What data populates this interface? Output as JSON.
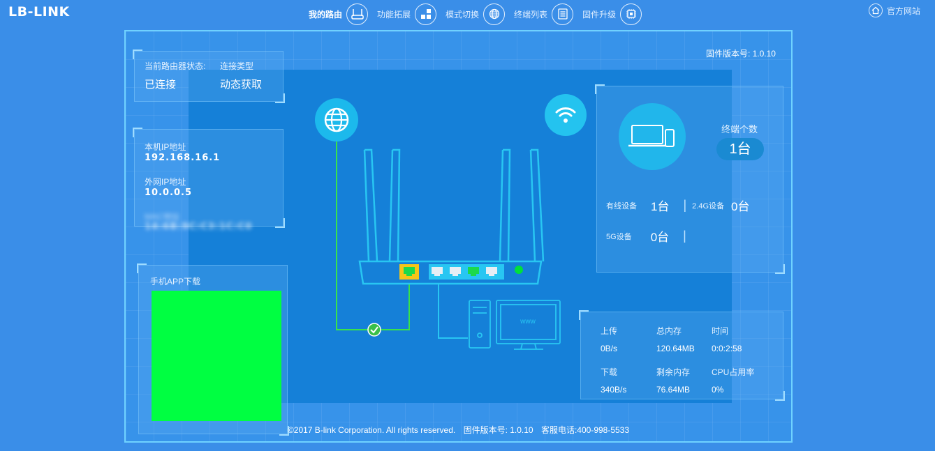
{
  "brand": {
    "logo": "LB-LINK"
  },
  "nav": {
    "items": [
      {
        "label": "我的路由",
        "icon": "router-icon",
        "active": true
      },
      {
        "label": "功能拓展",
        "icon": "grid-icon",
        "active": false
      },
      {
        "label": "模式切换",
        "icon": "globe-icon",
        "active": false
      },
      {
        "label": "终端列表",
        "icon": "list-icon",
        "active": false
      },
      {
        "label": "固件升级",
        "icon": "chip-icon",
        "active": false
      }
    ],
    "official_site": "官方网站"
  },
  "main": {
    "firmware_top": "固件版本号: 1.0.10",
    "status": {
      "router_status_label": "当前路由器状态:",
      "router_status_value": "已连接",
      "conn_type_label": "连接类型",
      "conn_type_value": "动态获取"
    },
    "network": {
      "local_ip_label": "本机IP地址",
      "local_ip_value": "192.168.16.1",
      "wan_ip_label": "外网IP地址",
      "wan_ip_value": "10.0.0.5",
      "mac_label": "MAC地址",
      "mac_value": "14:6B:9C:C3:1C:C0"
    },
    "app": {
      "label": "手机APP下载"
    },
    "monitor_text": "www",
    "devices": {
      "terminal_label": "终端个数",
      "terminal_count": "1台",
      "wired_label": "有线设备",
      "wired_value": "1台",
      "g24_label": "2.4G设备",
      "g24_value": "0台",
      "g5_label": "5G设备",
      "g5_value": "0台",
      "separator": "|"
    },
    "system": {
      "upload_label": "上传",
      "upload_value": "0B/s",
      "total_mem_label": "总内存",
      "total_mem_value": "120.64MB",
      "time_label": "时间",
      "time_value": "0:0:2:58",
      "download_label": "下载",
      "download_value": "340B/s",
      "free_mem_label": "剩余内存",
      "free_mem_value": "76.64MB",
      "cpu_label": "CPU占用率",
      "cpu_value": "0%"
    },
    "footer": {
      "copyright": "©2017 B-link Corporation. All rights reserved.",
      "firmware": "固件版本号: 1.0.10",
      "hotline": "客服电话:400-998-5533"
    }
  },
  "colors": {
    "background": "#3a8ee8",
    "panel": "#1580d8",
    "accent_cyan": "#22c3ef",
    "port_active": "#00e03c",
    "wan_port": "#f5c518",
    "qr_placeholder": "#00ff41"
  }
}
